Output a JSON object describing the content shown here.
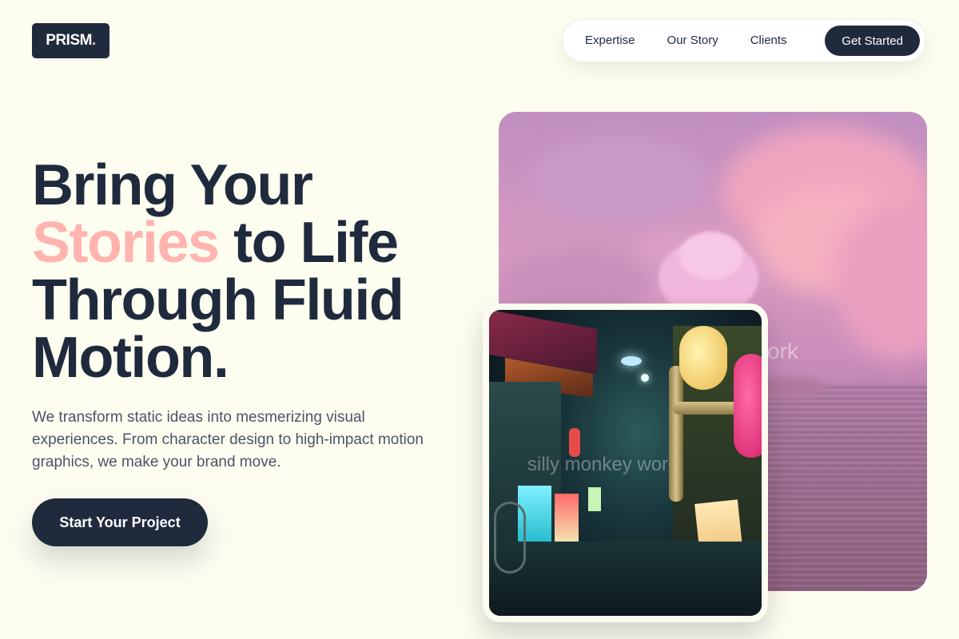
{
  "brand": {
    "name": "PRISM",
    "dot": "."
  },
  "nav": {
    "links": [
      "Expertise",
      "Our Story",
      "Clients"
    ],
    "cta": "Get Started"
  },
  "hero": {
    "title_line1": "Bring Your",
    "title_accent": "Stories",
    "title_line2_rest": " to Life",
    "title_line3": "Through Fluid",
    "title_line4": "Motion.",
    "subtitle": "We transform static ideas into mesmerizing visual experiences. From character design to high-impact motion graphics, we make your brand move.",
    "cta": "Start Your Project"
  },
  "images": {
    "back": {
      "watermark": "ork"
    },
    "front": {
      "watermark": "silly monkey wor"
    }
  },
  "colors": {
    "primary": "#1f2a3d",
    "accent": "#ffb4b0",
    "background": "#fdfdf0"
  }
}
